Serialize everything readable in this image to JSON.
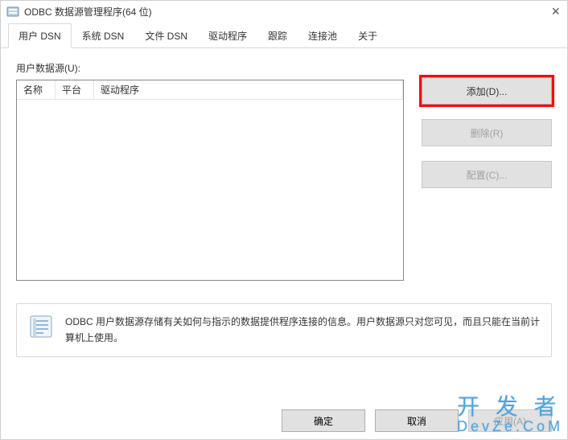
{
  "title": "ODBC 数据源管理程序(64 位)",
  "tabs": [
    "用户 DSN",
    "系统 DSN",
    "文件 DSN",
    "驱动程序",
    "跟踪",
    "连接池",
    "关于"
  ],
  "activeTabIndex": 0,
  "userDataSourceLabel": "用户数据源(U):",
  "columns": {
    "name": "名称",
    "platform": "平台",
    "driver": "驱动程序"
  },
  "buttons": {
    "add": "添加(D)...",
    "remove": "删除(R)",
    "configure": "配置(C)..."
  },
  "infoText": "ODBC 用户数据源存储有关如何与指示的数据提供程序连接的信息。用户数据源只对您可见，而且只能在当前计算机上使用。",
  "footer": {
    "ok": "确定",
    "cancel": "取消",
    "apply": "应用(A)"
  },
  "watermark": {
    "line1": "开 发 者",
    "line2": "DevZe.CoM"
  }
}
